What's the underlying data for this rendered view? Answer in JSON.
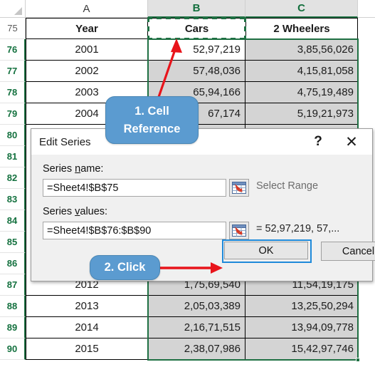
{
  "spreadsheet": {
    "columns": [
      {
        "label": "A",
        "selected": false
      },
      {
        "label": "B",
        "selected": true
      },
      {
        "label": "C",
        "selected": true
      }
    ],
    "row_numbers": [
      "75",
      "76",
      "77",
      "78",
      "79",
      "80",
      "81",
      "82",
      "83",
      "84",
      "85",
      "86",
      "87",
      "88",
      "89",
      "90"
    ],
    "header_row": {
      "a": "Year",
      "b": "Cars",
      "c": "2 Wheelers"
    },
    "rows": [
      {
        "row": "76",
        "year": "2001",
        "cars": "52,97,219",
        "two_wheelers": "3,85,56,026"
      },
      {
        "row": "77",
        "year": "2002",
        "cars": "57,48,036",
        "two_wheelers": "4,15,81,058"
      },
      {
        "row": "78",
        "year": "2003",
        "cars": "65,94,166",
        "two_wheelers": "4,75,19,489"
      },
      {
        "row": "79",
        "year": "2004",
        "cars": "67,174",
        "two_wheelers": "5,19,21,973"
      },
      {
        "row": "87",
        "year": "2012",
        "cars": "1,75,69,540",
        "two_wheelers": "11,54,19,175"
      },
      {
        "row": "88",
        "year": "2013",
        "cars": "2,05,03,389",
        "two_wheelers": "13,25,50,294"
      },
      {
        "row": "89",
        "year": "2014",
        "cars": "2,16,71,515",
        "two_wheelers": "13,94,09,778"
      },
      {
        "row": "90",
        "year": "2015",
        "cars": "2,38,07,986",
        "two_wheelers": "15,42,97,746"
      }
    ],
    "active_cell_fill": "#ffffff",
    "selection_fill": "#d4d4d4",
    "selection_border_color": "#1f7043",
    "marching_ants_cell": "B75"
  },
  "dialog": {
    "title": "Edit Series",
    "help_icon": "?",
    "close_icon": "✕",
    "series_name": {
      "label_pre": "Series ",
      "label_accel": "n",
      "label_post": "ame:",
      "value": "=Sheet4!$B$75",
      "placeholder": "",
      "range_icon": "select-range-icon",
      "side_text": "Select Range"
    },
    "series_values": {
      "label_pre": "Series ",
      "label_accel": "v",
      "label_post": "alues:",
      "value": "=Sheet4!$B$76:$B$90",
      "placeholder": "",
      "range_icon": "select-range-icon",
      "side_text": "= 52,97,219, 57,..."
    },
    "ok_label": "OK",
    "cancel_label": "Cancel",
    "focus_ring_color": "#1f8ada"
  },
  "annotations": {
    "callout_1": {
      "line1": "1. Cell",
      "line2": "Reference",
      "fill": "#5b9bd0"
    },
    "callout_2": {
      "line1": "2. Click",
      "line2": "",
      "fill": "#5b9bd0"
    },
    "arrow_color": "#e8141b"
  }
}
